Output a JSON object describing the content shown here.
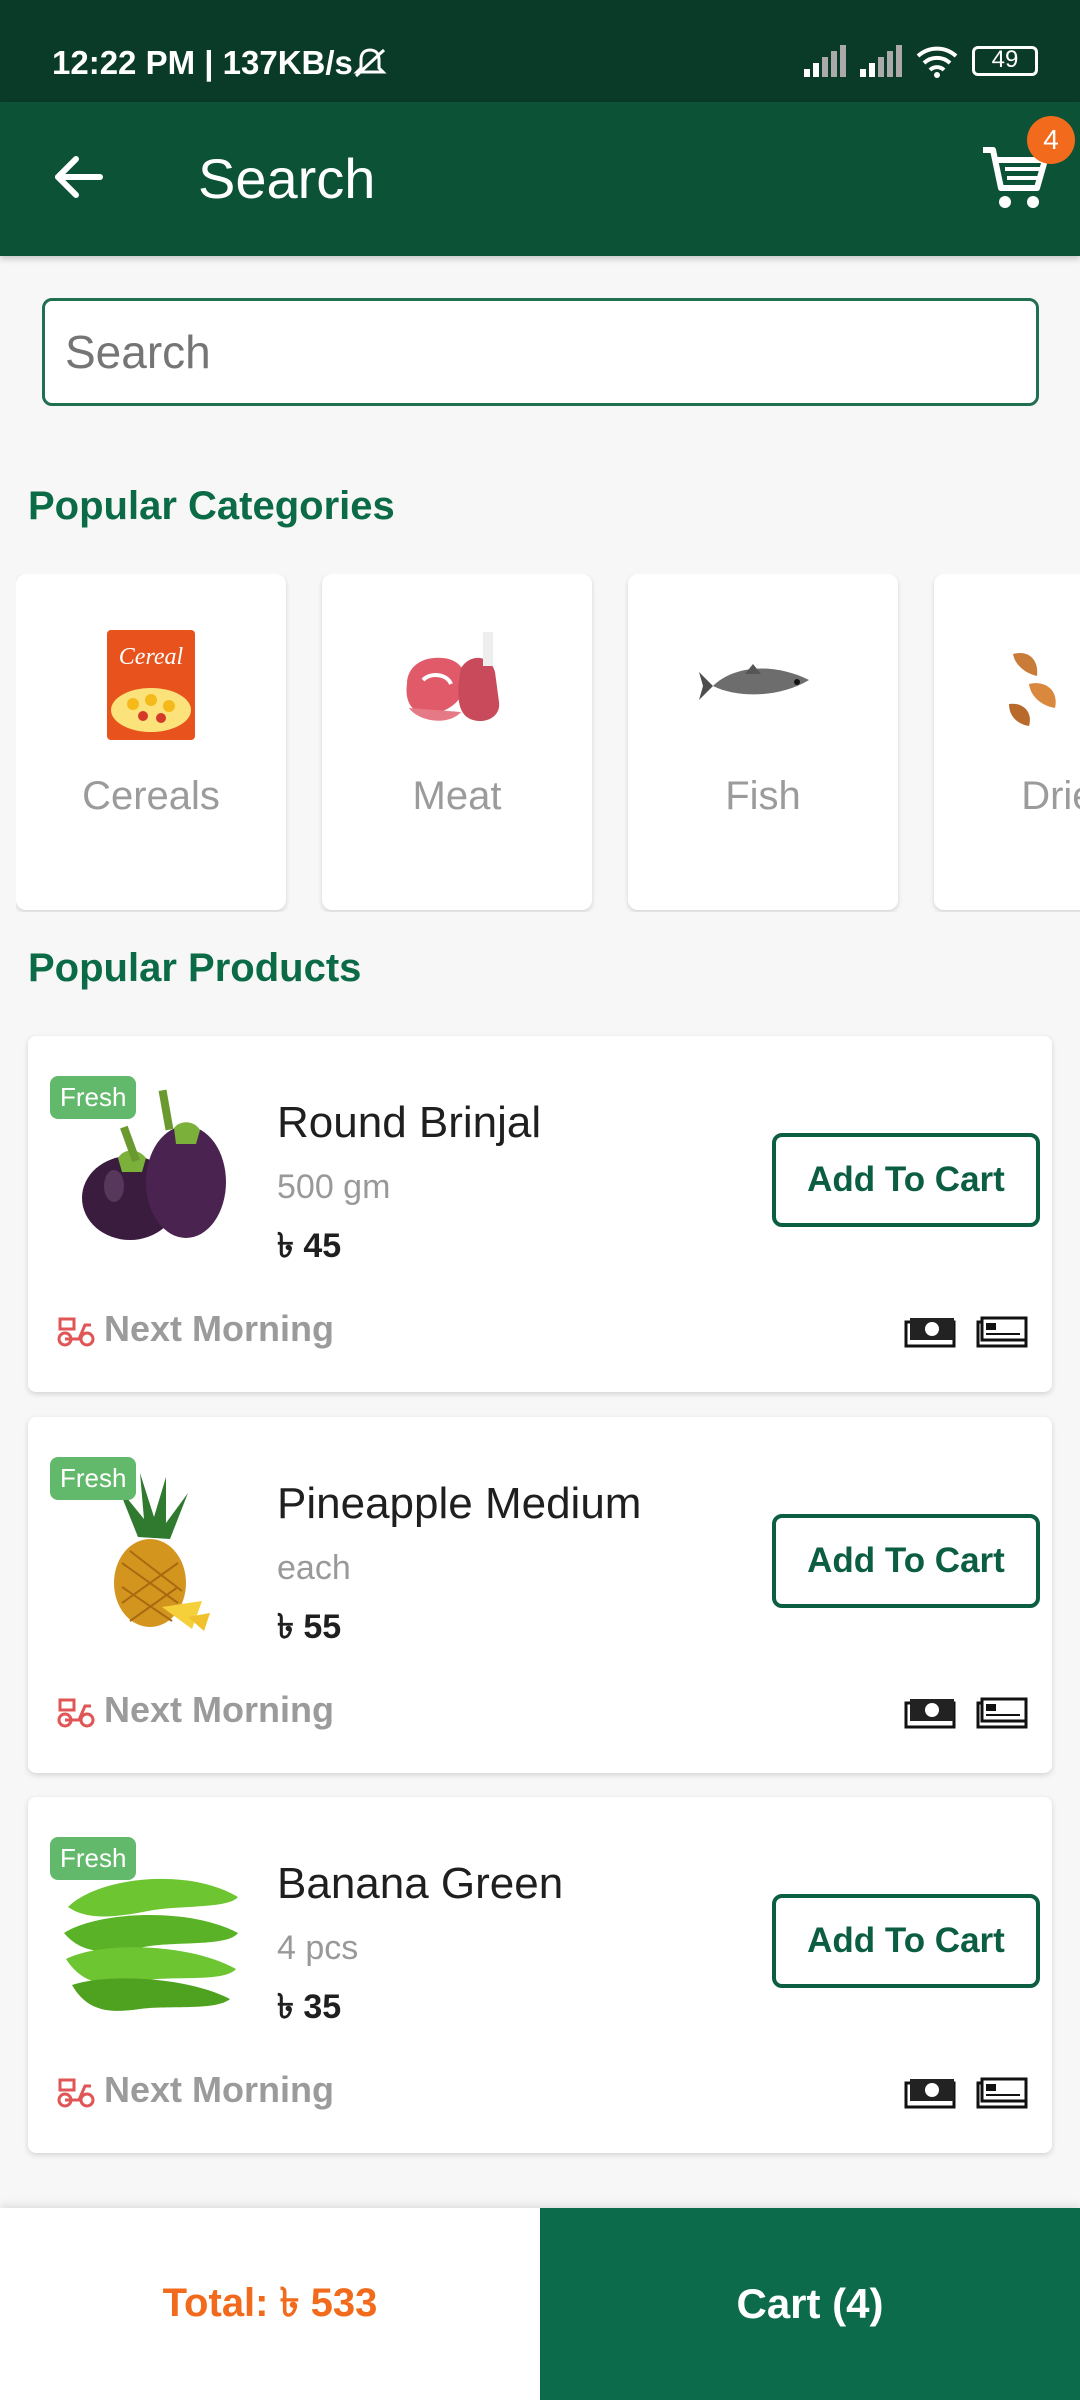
{
  "status_bar": {
    "time": "12:22 PM | 137KB/s",
    "battery": "49"
  },
  "header": {
    "title": "Search",
    "cart_badge": "4"
  },
  "search": {
    "placeholder": "Search"
  },
  "popular_categories": {
    "title": "Popular Categories",
    "items": [
      {
        "label": "Cereals",
        "icon": "cereal-box-icon"
      },
      {
        "label": "Meat",
        "icon": "meat-icon"
      },
      {
        "label": "Fish",
        "icon": "fish-icon"
      },
      {
        "label": "Dried",
        "icon": "dried-fish-icon"
      }
    ]
  },
  "popular_products": {
    "title": "Popular Products",
    "items": [
      {
        "badge": "Fresh",
        "name": "Round Brinjal",
        "unit": "500 gm",
        "price": "৳ 45",
        "button": "Add To Cart",
        "delivery": "Next Morning"
      },
      {
        "badge": "Fresh",
        "name": "Pineapple Medium",
        "unit": "each",
        "price": "৳ 55",
        "button": "Add To Cart",
        "delivery": "Next Morning"
      },
      {
        "badge": "Fresh",
        "name": "Banana Green",
        "unit": "4 pcs",
        "price": "৳ 35",
        "button": "Add To Cart",
        "delivery": "Next Morning"
      }
    ]
  },
  "footer": {
    "total": "Total: ৳ 533",
    "cart": "Cart (4)"
  },
  "colors": {
    "primary": "#0b5237",
    "accent": "#f26b1d",
    "fresh_badge": "#63b96b"
  }
}
